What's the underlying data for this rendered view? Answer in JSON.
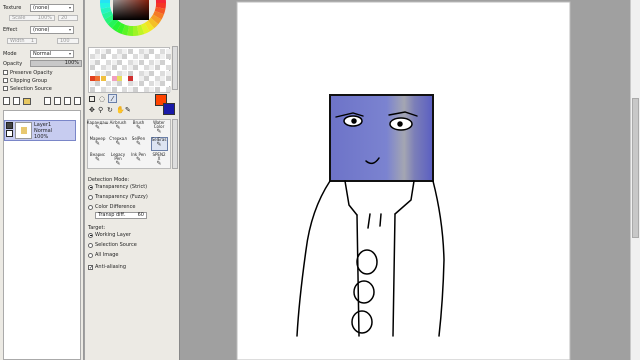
{
  "layer_props": {
    "texture_label": "Texture",
    "texture_value": "(none)",
    "scale_label": "Scale",
    "scale_value": "100%",
    "scale_num": "20",
    "effect_label": "Effect",
    "effect_value": "(none)",
    "width_label": "Width",
    "width_value": "1",
    "width_num": "100",
    "mode_label": "Mode",
    "mode_value": "Normal",
    "opacity_label": "Opacity",
    "opacity_value": "100%",
    "opacity_fraction": 1.0,
    "preserve_opacity": "Preserve Opacity",
    "clipping_group": "Clipping Group",
    "selection_source": "Selection Source"
  },
  "layer": {
    "name": "Layer1",
    "mode": "Normal",
    "opacity": "100%"
  },
  "tools": [
    {
      "label": "Карандаш",
      "icon": "pencil-icon"
    },
    {
      "label": "Airbrush",
      "icon": "airbrush-icon"
    },
    {
      "label": "Brush",
      "icon": "brush-icon"
    },
    {
      "label": "Water Color",
      "icon": "watercolor-icon"
    },
    {
      "label": "Маркер",
      "icon": "marker-icon"
    },
    {
      "label": "Стеркал",
      "icon": "eraser-icon"
    },
    {
      "label": "SelPen",
      "icon": "selpen-icon"
    },
    {
      "label": "SelEras",
      "icon": "seleraser-icon"
    },
    {
      "label": "Bнарис",
      "icon": "bucket-icon"
    },
    {
      "label": "Legacy Pen",
      "icon": "legacy-pen-icon"
    },
    {
      "label": "Ink Pen",
      "icon": "ink-pen-icon"
    },
    {
      "label": "SPEN2 X",
      "icon": "spen-icon"
    }
  ],
  "tool_options": {
    "detection_mode_label": "Detection Mode:",
    "transparency_strict": "Transparency (Strict)",
    "transparency_fuzzy": "Transparency (Fuzzy)",
    "color_difference": "Color Difference",
    "transp_diff_label": "Transp diff.",
    "transp_diff_value": "60",
    "target_label": "Target:",
    "working_layer": "Working Layer",
    "selection_source": "Selection Source",
    "all_image": "All Image",
    "anti_aliasing": "Anti-aliasing"
  },
  "colors": {
    "primary": "#ff4400",
    "secondary": "#1a1aa8",
    "panel_bg": "#eceae4",
    "canvas_bg": "#a0a0a0"
  }
}
